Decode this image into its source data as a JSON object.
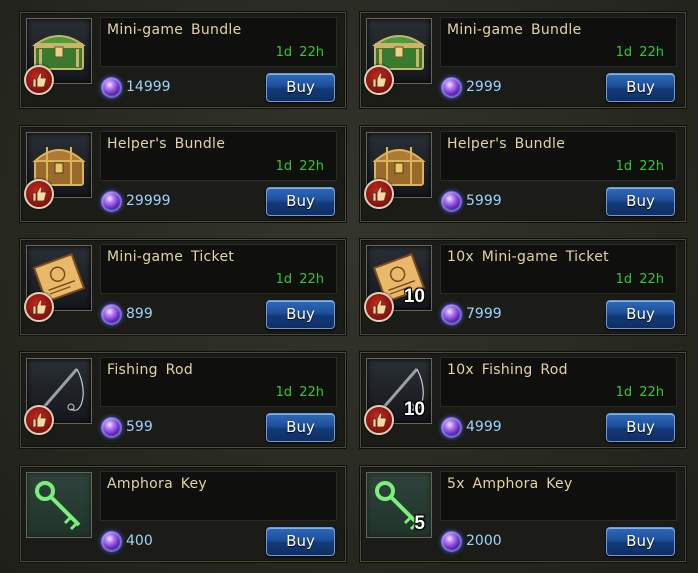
{
  "shop": {
    "buy_label": "Buy",
    "items": [
      {
        "name": "Mini-game Bundle",
        "timer": "1d 22h",
        "price": "14999",
        "quantity": "",
        "icon": "green-chest-icon",
        "liked": true
      },
      {
        "name": "Mini-game Bundle",
        "timer": "1d 22h",
        "price": "2999",
        "quantity": "",
        "icon": "green-chest-icon",
        "liked": true
      },
      {
        "name": "Helper's Bundle",
        "timer": "1d 22h",
        "price": "29999",
        "quantity": "",
        "icon": "wooden-chest-icon",
        "liked": true
      },
      {
        "name": "Helper's Bundle",
        "timer": "1d 22h",
        "price": "5999",
        "quantity": "",
        "icon": "wooden-chest-icon",
        "liked": true
      },
      {
        "name": "Mini-game Ticket",
        "timer": "1d 22h",
        "price": "899",
        "quantity": "",
        "icon": "ticket-icon",
        "liked": true
      },
      {
        "name": "10x Mini-game Ticket",
        "timer": "1d 22h",
        "price": "7999",
        "quantity": "10",
        "icon": "ticket-icon",
        "liked": true
      },
      {
        "name": "Fishing Rod",
        "timer": "1d 22h",
        "price": "599",
        "quantity": "",
        "icon": "fishing-rod-icon",
        "liked": true
      },
      {
        "name": "10x Fishing Rod",
        "timer": "1d 22h",
        "price": "4999",
        "quantity": "10",
        "icon": "fishing-rod-icon",
        "liked": true
      },
      {
        "name": "Amphora Key",
        "timer": "",
        "price": "400",
        "quantity": "",
        "icon": "green-key-icon",
        "liked": false
      },
      {
        "name": "5x Amphora Key",
        "timer": "",
        "price": "2000",
        "quantity": "5",
        "icon": "green-key-icon",
        "liked": false
      }
    ]
  },
  "colors": {
    "item_name": "#e4d3a4",
    "timer": "#32c832",
    "price": "#9fd2ff",
    "buy_button": "#1d4f9a",
    "like_badge": "#c62a20"
  }
}
